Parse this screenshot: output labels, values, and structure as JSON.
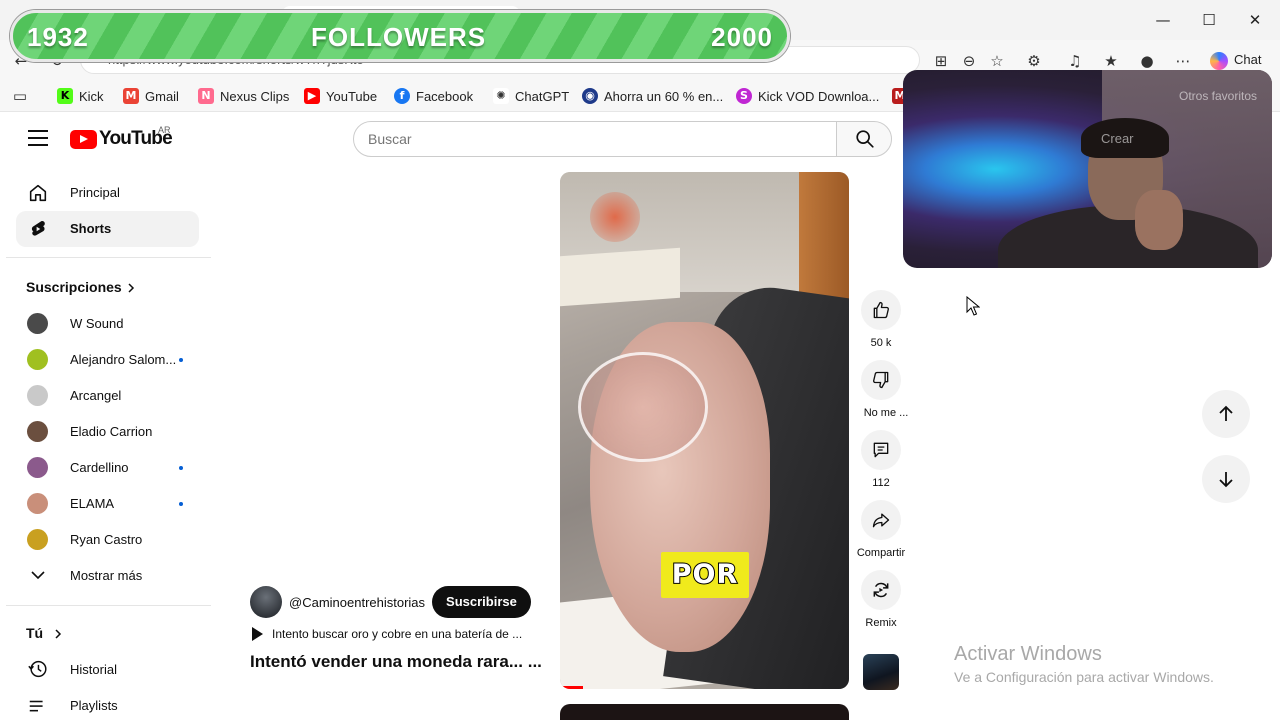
{
  "browser": {
    "url": "https://www.youtube.com/shorts/wTnTjdsKto",
    "chat_label": "Chat",
    "window_controls": {
      "minimize": "—",
      "maximize": "☐",
      "close": "✕"
    },
    "toolbar_icons": [
      "apps-icon",
      "zoom-icon",
      "favorite-star-icon",
      "extensions-icon",
      "media-icon",
      "favorites-icon",
      "profile-icon",
      "more-icon"
    ]
  },
  "bookmarks": [
    {
      "label": "Kick",
      "color": "#53fc18"
    },
    {
      "label": "Gmail",
      "color": "#ea4335"
    },
    {
      "label": "Nexus Clips",
      "color": "#ff6a8e"
    },
    {
      "label": "YouTube",
      "color": "#ff0000"
    },
    {
      "label": "Facebook",
      "color": "#1877f2"
    },
    {
      "label": "ChatGPT",
      "color": "#333333"
    },
    {
      "label": "Ahorra un 60 % en...",
      "color": "#1e3a8a"
    },
    {
      "label": "Kick VOD Downloa...",
      "color": "#c026d3"
    }
  ],
  "overlay": {
    "followers_current": "1932",
    "followers_label": "FOLLOWERS",
    "followers_goal": "2000"
  },
  "webcam_ghost": {
    "create_label": "Crear",
    "other_favorites": "Otros favoritos"
  },
  "youtube": {
    "country": "AR",
    "search_placeholder": "Buscar",
    "nav": {
      "home": "Principal",
      "shorts": "Shorts"
    },
    "subscriptions_title": "Suscripciones",
    "subscriptions": [
      {
        "name": "W Sound",
        "new": false,
        "color": "#4a4a4a"
      },
      {
        "name": "Alejandro Salom...",
        "new": true,
        "color": "#a0c020"
      },
      {
        "name": "Arcangel",
        "new": false,
        "color": "#c9c9c9"
      },
      {
        "name": "Eladio Carrion",
        "new": false,
        "color": "#6b4f3f"
      },
      {
        "name": "Cardellino",
        "new": true,
        "color": "#8b5a8c"
      },
      {
        "name": "ELAMA",
        "new": true,
        "color": "#c98f7a"
      },
      {
        "name": "Ryan Castro",
        "new": false,
        "color": "#c9a020"
      }
    ],
    "show_more": "Mostrar más",
    "you_title": "Tú",
    "you_items": {
      "history": "Historial",
      "playlists": "Playlists"
    },
    "short": {
      "caption": "POR",
      "channel": "@Caminoentrehistorias",
      "subscribe_label": "Suscribirse",
      "related": "Intento buscar oro y cobre en una batería de ...",
      "title": "Intentó vender una moneda rara... ...",
      "progress": 0.08
    },
    "actions": {
      "likes": "50 k",
      "dislike": "No me ...",
      "comments": "112",
      "share": "Compartir",
      "remix": "Remix"
    }
  },
  "windows_watermark": {
    "line1": "Activar Windows",
    "line2": "Ve a Configuración para activar Windows."
  }
}
